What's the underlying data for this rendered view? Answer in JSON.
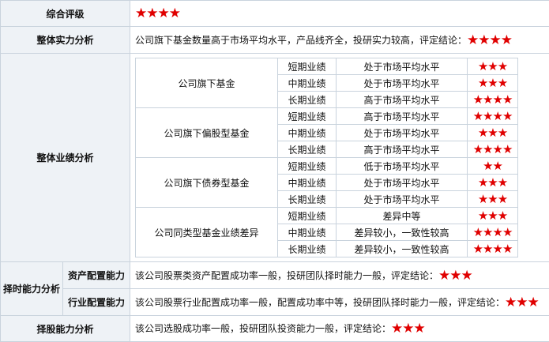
{
  "rows": {
    "overall": {
      "label": "综合评级",
      "stars": "★★★★"
    },
    "strength": {
      "label": "整体实力分析",
      "text": "公司旗下基金数量高于市场平均水平，产品线齐全，投研实力较高，评定结论：",
      "stars": "★★★★"
    },
    "performance": {
      "label": "整体业绩分析",
      "groups": [
        {
          "name": "公司旗下基金",
          "periods": [
            {
              "period": "短期业绩",
              "desc": "处于市场平均水平",
              "stars": "★★★"
            },
            {
              "period": "中期业绩",
              "desc": "处于市场平均水平",
              "stars": "★★★"
            },
            {
              "period": "长期业绩",
              "desc": "高于市场平均水平",
              "stars": "★★★★"
            }
          ]
        },
        {
          "name": "公司旗下偏股型基金",
          "periods": [
            {
              "period": "短期业绩",
              "desc": "高于市场平均水平",
              "stars": "★★★★"
            },
            {
              "period": "中期业绩",
              "desc": "处于市场平均水平",
              "stars": "★★★"
            },
            {
              "period": "长期业绩",
              "desc": "高于市场平均水平",
              "stars": "★★★★"
            }
          ]
        },
        {
          "name": "公司旗下债券型基金",
          "periods": [
            {
              "period": "短期业绩",
              "desc": "低于市场平均水平",
              "stars": "★★"
            },
            {
              "period": "中期业绩",
              "desc": "处于市场平均水平",
              "stars": "★★★"
            },
            {
              "period": "长期业绩",
              "desc": "处于市场平均水平",
              "stars": "★★★"
            }
          ]
        },
        {
          "name": "公司同类型基金业绩差异",
          "periods": [
            {
              "period": "短期业绩",
              "desc": "差异中等",
              "stars": "★★★"
            },
            {
              "period": "中期业绩",
              "desc": "差异较小，一致性较高",
              "stars": "★★★★"
            },
            {
              "period": "长期业绩",
              "desc": "差异较小，一致性较高",
              "stars": "★★★★"
            }
          ]
        }
      ]
    },
    "timing": {
      "label": "择时能力分析",
      "asset": {
        "label": "资产配置能力",
        "text": "该公司股票类资产配置成功率一般，投研团队择时能力一般，评定结论：",
        "stars": "★★★"
      },
      "industry": {
        "label": "行业配置能力",
        "text": "该公司股票行业配置成功率一般，配置成功率中等，投研团队择时能力一般，评定结论：",
        "stars": "★★★"
      }
    },
    "stock": {
      "label": "择股能力分析",
      "text": "该公司选股成功率一般，投研团队投资能力一般，评定结论：",
      "stars": "★★★"
    }
  },
  "colors": {
    "star": "#e00000",
    "label_bg": "#eef2f6",
    "border": "#c9d3dd"
  }
}
